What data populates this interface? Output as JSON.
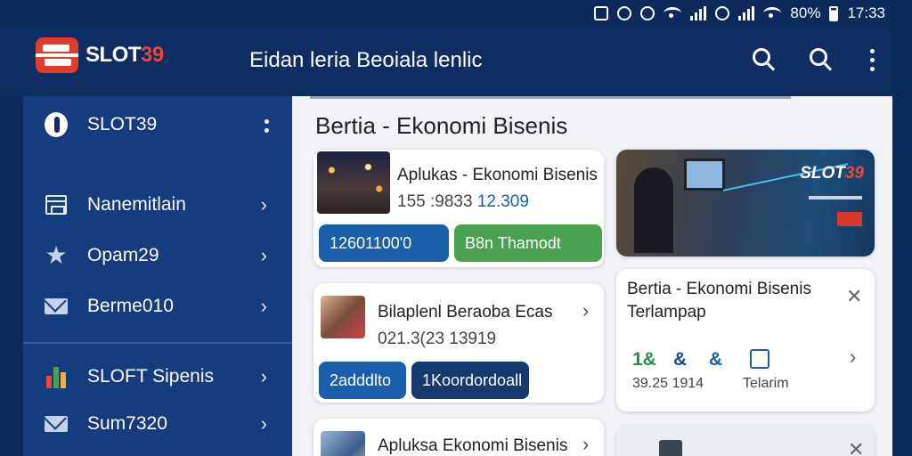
{
  "status_bar": {
    "battery": "80%",
    "time": "17:33"
  },
  "header": {
    "logo_part_a": "SLOT",
    "logo_part_b": "39",
    "title": "Eidan leria Beoiala lenlic"
  },
  "sidebar": {
    "account_label": "SLOT39",
    "items": [
      {
        "label": "Nanemitlain",
        "icon": "calendar-icon"
      },
      {
        "label": "Opam29",
        "icon": "star-icon"
      },
      {
        "label": "Berme010",
        "icon": "mail-icon"
      },
      {
        "label": "SLOFT Sipenis",
        "icon": "bar-chart-icon"
      },
      {
        "label": "Sum7320",
        "icon": "mail-icon"
      }
    ]
  },
  "main": {
    "section_title": "Bertia - Ekonomi Bisenis",
    "card1": {
      "title": "Aplukas - Ekonomi Bisenis",
      "meta_a": "155 :9833",
      "meta_b": "12.309",
      "btn_primary": "12601100'0",
      "btn_secondary": "B8n Thamodt"
    },
    "banner": {
      "logo_a": "SLOT",
      "logo_b": "39"
    },
    "card2": {
      "title": "Bilaplenl Beraoba Ecas",
      "meta": "021.3(23 13919",
      "btn_primary": "2adddlto",
      "btn_secondary": "1Koordordoall"
    },
    "card3": {
      "title_line1": "Bertia - Ekonomi Bisenis",
      "title_line2": "Terlampap",
      "stat_a": "1&",
      "stat_b": "&",
      "stat_c": "&",
      "meta": "39.25 1914",
      "meta_b": "Telarim"
    },
    "card4": {
      "title": "Apluksa Ekonomi Bisenis"
    }
  },
  "colors": {
    "header_bg": "#0e2d62",
    "sidebar_bg": "#143c7e",
    "accent_red": "#e8473a",
    "pill_blue": "#1b5eab",
    "pill_green": "#4aa14f"
  }
}
